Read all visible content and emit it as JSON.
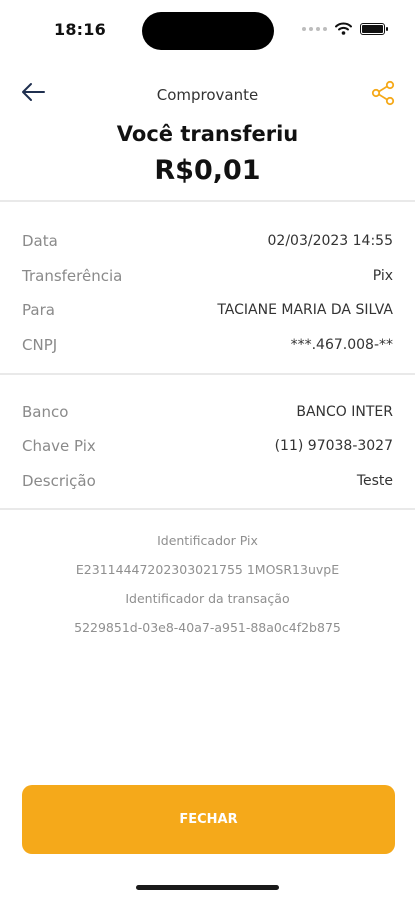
{
  "status_bar": {
    "time": "18:16"
  },
  "nav": {
    "title": "Comprovante"
  },
  "headline": "Você transferiu",
  "amount": "R$0,01",
  "section1": [
    {
      "label": "Data",
      "value": "02/03/2023 14:55"
    },
    {
      "label": "Transferência",
      "value": "Pix"
    },
    {
      "label": "Para",
      "value": "TACIANE MARIA DA SILVA"
    },
    {
      "label": "CNPJ",
      "value": "***.467.008-**"
    }
  ],
  "section2": [
    {
      "label": "Banco",
      "value": "BANCO INTER"
    },
    {
      "label": "Chave Pix",
      "value": "(11) 97038-3027"
    },
    {
      "label": "Descrição",
      "value": "Teste"
    }
  ],
  "identifiers": {
    "pix_label": "Identificador Pix",
    "pix_value": "E23114447202303021755 1MOSR13uvpE",
    "transaction_label": "Identificador da transação",
    "transaction_value": "5229851d-03e8-40a7-a951-88a0c4f2b875"
  },
  "actions": {
    "close_label": "FECHAR"
  },
  "colors": {
    "accent": "#f5a91a",
    "back_icon": "#1f2f4f",
    "share_icon": "#f5a91a"
  },
  "icons": {
    "back": "arrow-left-icon",
    "share": "share-icon"
  }
}
